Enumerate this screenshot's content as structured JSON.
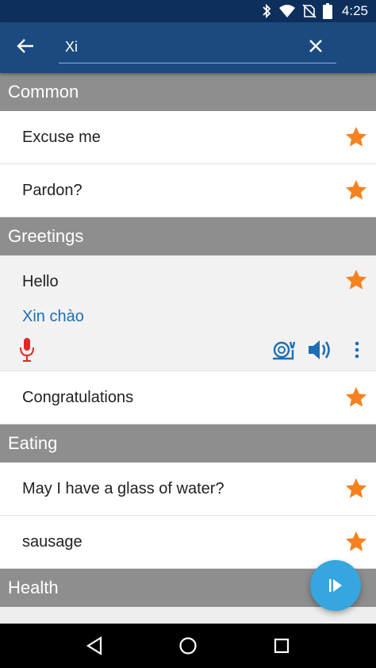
{
  "status": {
    "time": "4:25"
  },
  "search": {
    "value": "Xi",
    "placeholder": ""
  },
  "sections": {
    "common": {
      "title": "Common",
      "items": [
        {
          "label": "Excuse me"
        },
        {
          "label": "Pardon?"
        }
      ]
    },
    "greetings": {
      "title": "Greetings",
      "expanded": {
        "label": "Hello",
        "translation": "Xin chào"
      },
      "items": [
        {
          "label": "Congratulations"
        }
      ]
    },
    "eating": {
      "title": "Eating",
      "items": [
        {
          "label": "May I have a glass of water?"
        },
        {
          "label": "sausage"
        }
      ]
    },
    "health": {
      "title": "Health"
    }
  },
  "colors": {
    "status_bar": "#0d2f5c",
    "app_bar": "#1a4a80",
    "section_header": "#8e8e8e",
    "star": "#f5821f",
    "translation": "#1e6eb4",
    "mic": "#e0282a",
    "fab": "#35a6df"
  },
  "icons": [
    "bluetooth-icon",
    "wifi-icon",
    "no-sim-icon",
    "battery-icon",
    "back-arrow-icon",
    "close-icon",
    "star-icon",
    "microphone-icon",
    "snail-icon",
    "speaker-icon",
    "more-vert-icon",
    "play-icon",
    "nav-back-icon",
    "nav-home-icon",
    "nav-recents-icon"
  ]
}
